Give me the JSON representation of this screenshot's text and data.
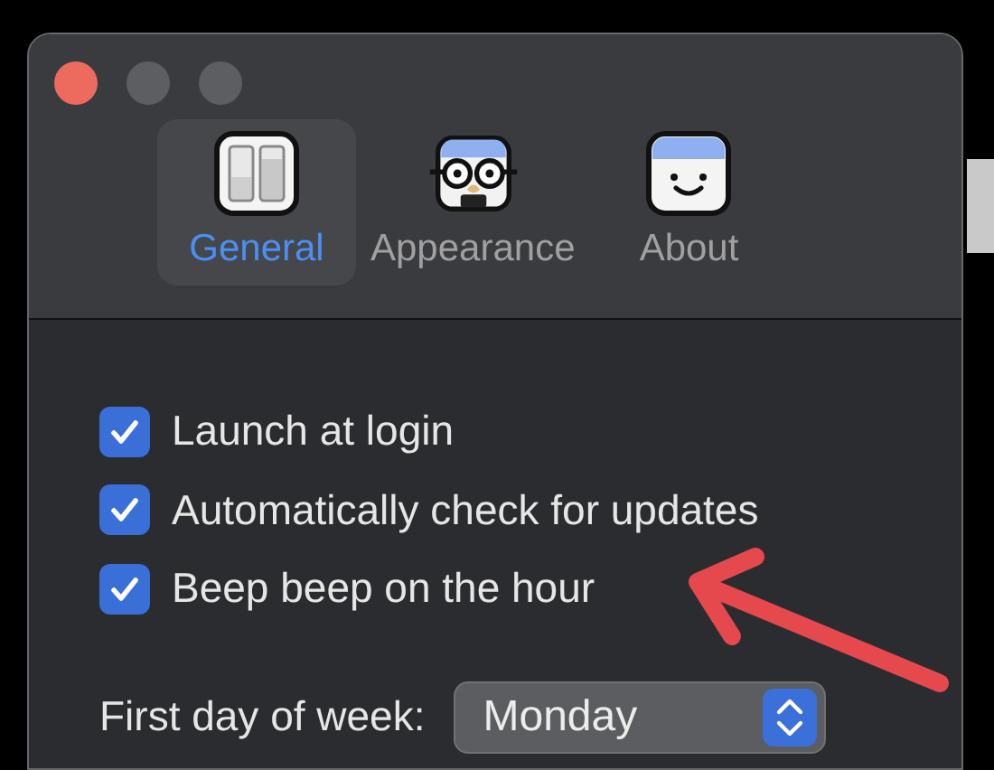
{
  "window": {
    "traffic_lights": [
      {
        "kind": "close"
      },
      {
        "kind": "minimize"
      },
      {
        "kind": "zoom"
      }
    ]
  },
  "tabs": [
    {
      "label": "General",
      "kind": "switches",
      "selected": true
    },
    {
      "label": "Appearance",
      "kind": "disguise",
      "selected": false
    },
    {
      "label": "About",
      "kind": "smiley",
      "selected": false
    }
  ],
  "options": [
    {
      "label": "Launch at login",
      "checked": true
    },
    {
      "label": "Automatically check for updates",
      "checked": true
    },
    {
      "label": "Beep beep on the hour",
      "checked": true
    }
  ],
  "first_day": {
    "label": "First day of week:",
    "value": "Monday"
  },
  "annotations": [
    {
      "kind": "arrow"
    }
  ]
}
